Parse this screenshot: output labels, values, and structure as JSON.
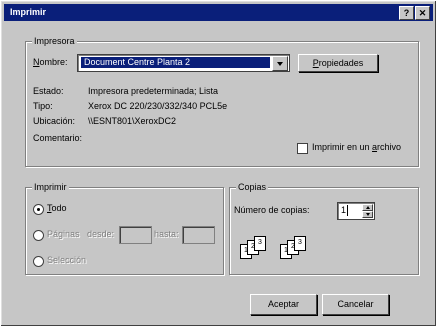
{
  "window": {
    "title": "Imprimir",
    "help": "?",
    "close": "✕"
  },
  "printer": {
    "legend": "Impresora",
    "name_label_u": "N",
    "name_label_rest": "ombre:",
    "selected_printer": "Document Centre Planta 2",
    "properties_u": "P",
    "properties_rest": "ropiedades",
    "state_label": "Estado:",
    "state_value": "Impresora predeterminada; Lista",
    "type_label": "Tipo:",
    "type_value": "Xerox DC 220/230/332/340 PCL5e",
    "location_label": "Ubicación:",
    "location_value": "\\\\ESNT801\\XeroxDC2",
    "comment_label": "Comentario:",
    "print_to_file_pre": "Imprimir en un ",
    "print_to_file_u": "a",
    "print_to_file_post": "rchivo"
  },
  "range": {
    "legend": "Imprimir",
    "all_u": "T",
    "all_rest": "odo",
    "pages_label": "Páginas",
    "from_label": "desde:",
    "to_label": "hasta:",
    "selection_label": "Selección"
  },
  "copies": {
    "legend": "Copias",
    "num_label": "Número de copias:",
    "num_value": "1",
    "pages": [
      "1",
      "2",
      "3",
      "1",
      "2",
      "3"
    ]
  },
  "footer": {
    "ok": "Aceptar",
    "cancel": "Cancelar"
  }
}
